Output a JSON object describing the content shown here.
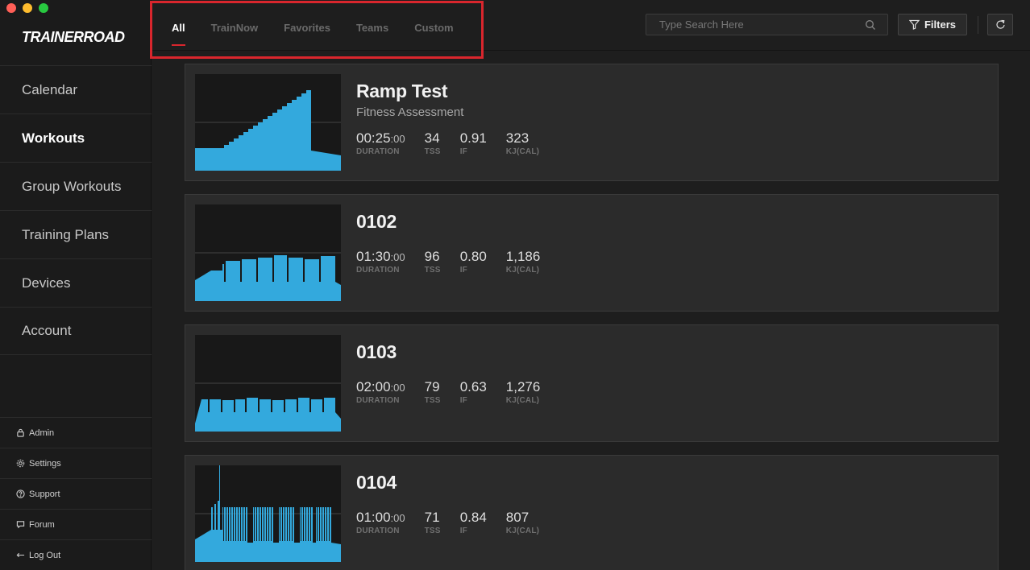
{
  "app": {
    "logo": "TRAINERROAD"
  },
  "sidebar": {
    "items": [
      {
        "label": "Calendar"
      },
      {
        "label": "Workouts"
      },
      {
        "label": "Group Workouts"
      },
      {
        "label": "Training Plans"
      },
      {
        "label": "Devices"
      },
      {
        "label": "Account"
      }
    ],
    "active": "Workouts",
    "utility": [
      {
        "label": "Admin",
        "icon": "lock-icon"
      },
      {
        "label": "Settings",
        "icon": "gear-icon"
      },
      {
        "label": "Support",
        "icon": "question-icon"
      },
      {
        "label": "Forum",
        "icon": "chat-icon"
      },
      {
        "label": "Log Out",
        "icon": "arrow-left-icon"
      }
    ]
  },
  "tabs": [
    {
      "label": "All",
      "active": true
    },
    {
      "label": "TrainNow"
    },
    {
      "label": "Favorites"
    },
    {
      "label": "Teams"
    },
    {
      "label": "Custom"
    }
  ],
  "search": {
    "placeholder": "Type Search Here"
  },
  "toolbar": {
    "filters_label": "Filters"
  },
  "colors": {
    "accent": "#d9262d",
    "graph": "#33a9dd"
  },
  "workouts": [
    {
      "title": "Ramp Test",
      "subtitle": "Fitness Assessment",
      "duration": "00:25",
      "duration_seconds": ":00",
      "tss": "34",
      "if": "0.91",
      "kj": "323"
    },
    {
      "title": "0102",
      "subtitle": "",
      "duration": "01:30",
      "duration_seconds": ":00",
      "tss": "96",
      "if": "0.80",
      "kj": "1,186"
    },
    {
      "title": "0103",
      "subtitle": "",
      "duration": "02:00",
      "duration_seconds": ":00",
      "tss": "79",
      "if": "0.63",
      "kj": "1,276"
    },
    {
      "title": "0104",
      "subtitle": "",
      "duration": "01:00",
      "duration_seconds": ":00",
      "tss": "71",
      "if": "0.84",
      "kj": "807"
    }
  ],
  "labels": {
    "duration": "DURATION",
    "tss": "TSS",
    "if": "IF",
    "kj": "KJ(CAL)"
  }
}
